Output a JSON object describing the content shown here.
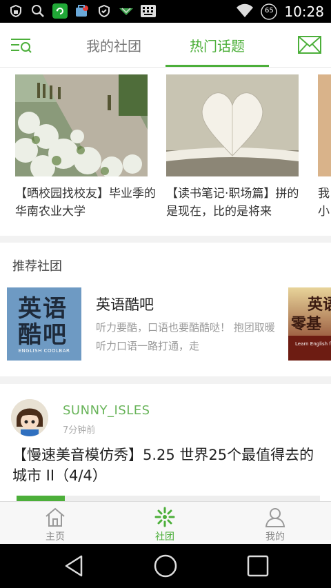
{
  "status_bar": {
    "time": "10:28",
    "battery_level": "65",
    "icons": [
      "lock-icon",
      "search-icon",
      "refresh-icon",
      "app-badge-icon",
      "shield-icon",
      "signal-arrow-icon",
      "keyboard-icon",
      "wifi-icon",
      "battery-icon"
    ]
  },
  "header": {
    "tabs": [
      {
        "label": "我的社团",
        "active": false
      },
      {
        "label": "热门话题",
        "active": true
      }
    ],
    "accent_color": "#4caf3a"
  },
  "hot_topics": [
    {
      "title": "【晒校园找校友】毕业季的华南农业大学"
    },
    {
      "title": "【读书笔记·职场篇】拼的是现在，比的是将来"
    },
    {
      "title": "我小"
    }
  ],
  "recommended": {
    "heading": "推荐社团",
    "clubs": [
      {
        "name": "英语酷吧",
        "description": "听力要酷，口语也要酷酷哒！ 抱团取暖听力口语一路打通，走",
        "logo_text_1": "英语",
        "logo_text_2": "酷吧",
        "logo_caption": "ENGLISH COOLBAR"
      },
      {
        "logo_text_1": "英语",
        "logo_text_2": "零基",
        "logo_caption": "Learn English fr"
      }
    ]
  },
  "feed": {
    "post": {
      "username": "SUNNY_ISLES",
      "time_ago": "7分钟前",
      "title": "【慢速美音模仿秀】5.25 世界25个最值得去的城市 II（4/4）",
      "progress": 0.16
    }
  },
  "bottom_nav": {
    "items": [
      {
        "label": "主页",
        "active": false
      },
      {
        "label": "社团",
        "active": true
      },
      {
        "label": "我的",
        "active": false
      }
    ]
  }
}
